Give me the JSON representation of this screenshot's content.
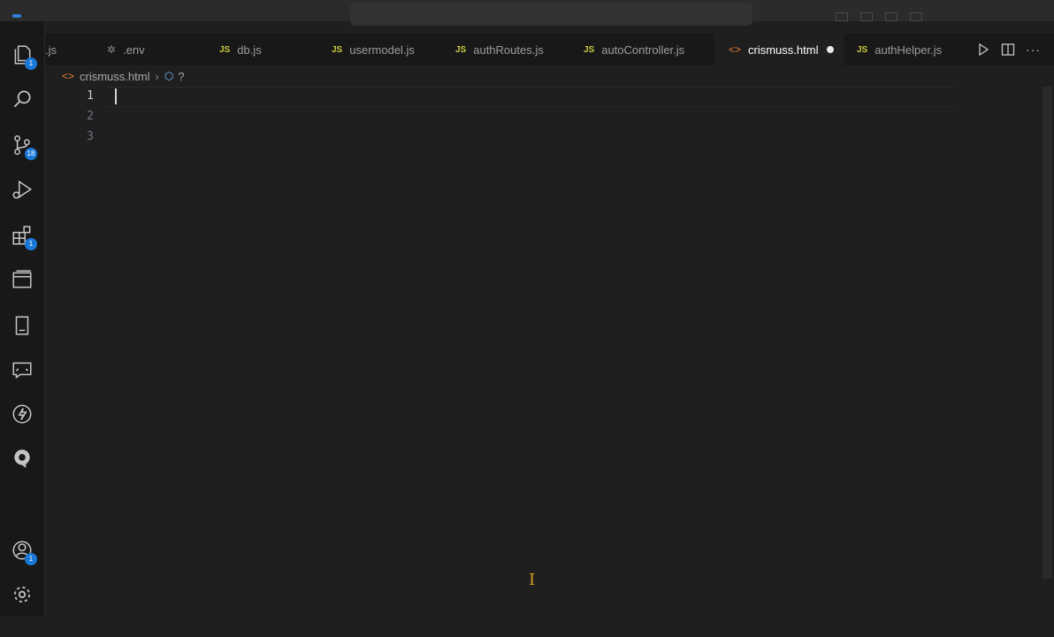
{
  "activity_bar": {
    "explorer_badge": "1",
    "source_control_badge": "18",
    "extensions_badge": "1",
    "accounts_badge": "1"
  },
  "tabs": [
    {
      "label": ".js",
      "icon": "none"
    },
    {
      "label": ".env",
      "icon": "gear-icon"
    },
    {
      "label": "db.js",
      "icon": "js-icon",
      "icon_text": "JS"
    },
    {
      "label": "usermodel.js",
      "icon": "js-icon",
      "icon_text": "JS"
    },
    {
      "label": "authRoutes.js",
      "icon": "js-icon",
      "icon_text": "JS"
    },
    {
      "label": "autoController.js",
      "icon": "js-icon",
      "icon_text": "JS"
    },
    {
      "label": "crismuss.html",
      "icon": "html-icon",
      "active": true,
      "modified": true
    },
    {
      "label": "authHelper.js",
      "icon": "js-icon",
      "icon_text": "JS"
    }
  ],
  "breadcrumb": {
    "file": "crismuss.html",
    "symbol": "?"
  },
  "editor": {
    "line_numbers": [
      "1",
      "2",
      "3"
    ],
    "current_line": 1
  },
  "colors": {
    "background": "#1f1f1f",
    "activity_bar": "#181818",
    "badge": "#1a78d6",
    "js_icon": "#cbcb41",
    "html_icon": "#e37933"
  }
}
